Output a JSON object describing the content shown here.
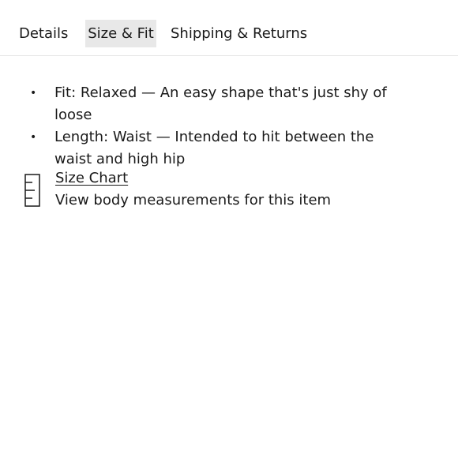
{
  "tabs": [
    {
      "label": "Details"
    },
    {
      "label": "Size & Fit",
      "active": true
    },
    {
      "label": "Shipping & Returns"
    }
  ],
  "fit": {
    "items": [
      {
        "text": "Fit: Relaxed — An easy shape that's just shy of loose"
      },
      {
        "text": "Length: Waist — Intended to hit between the waist and high hip"
      }
    ]
  },
  "size_chart": {
    "icon": "ruler-icon",
    "link_label": "Size Chart",
    "description": "View body measurements for this item"
  },
  "colors": {
    "text": "#1a1a1a",
    "active_tab_bg": "#e8e8e8",
    "divider": "#e6e6e6"
  }
}
